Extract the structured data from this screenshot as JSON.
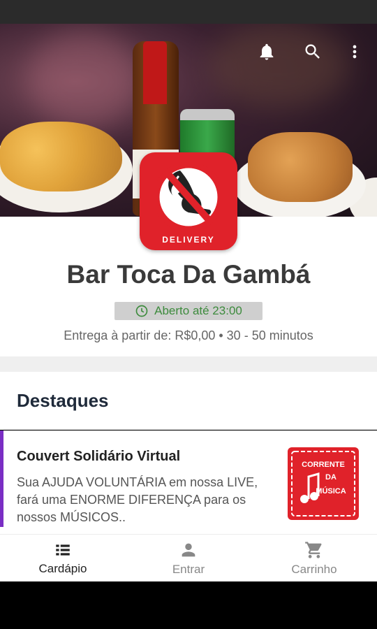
{
  "header": {
    "icons": [
      "bell-icon",
      "search-icon",
      "more-vertical-icon"
    ]
  },
  "store": {
    "logo_text": "DELIVERY",
    "name": "Bar Toca Da Gambá",
    "open_status": "Aberto até 23:00",
    "delivery_info": "Entrega à partir de: R$0,00 • 30 - 50 minutos"
  },
  "highlights": {
    "title": "Destaques",
    "items": [
      {
        "name": "Couvert Solidário Virtual",
        "description": "Sua AJUDA VOLUNTÁRIA em nossa LIVE, fará uma ENORME  DIFERENÇA para os nossos  MÚSICOS..",
        "image_text": [
          "CORRENTE",
          "DA",
          "MÚSICA"
        ]
      }
    ]
  },
  "bottom_nav": {
    "items": [
      {
        "label": "Cardápio",
        "icon": "menu-list-icon",
        "active": true
      },
      {
        "label": "Entrar",
        "icon": "person-icon",
        "active": false
      },
      {
        "label": "Carrinho",
        "icon": "cart-icon",
        "active": false
      }
    ]
  },
  "colors": {
    "brand_red": "#e0222a",
    "accent_purple": "#7a2ec4",
    "open_green": "#3d8b3d"
  }
}
